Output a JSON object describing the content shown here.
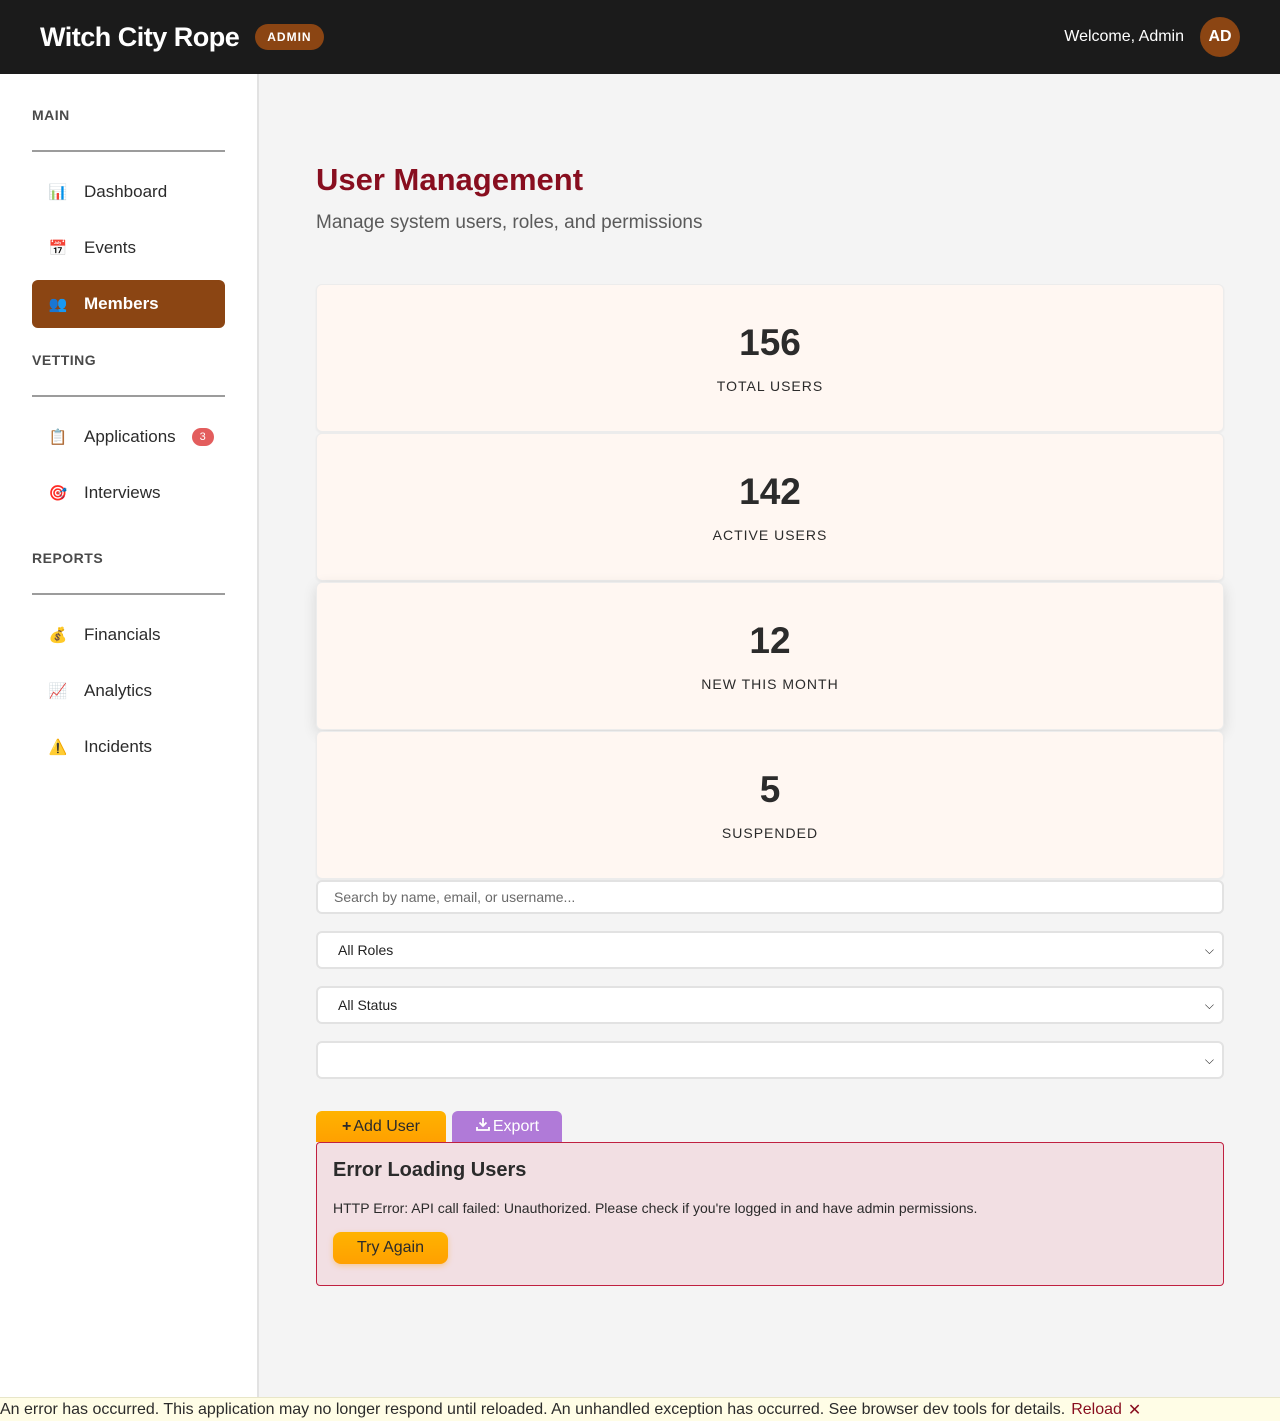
{
  "header": {
    "brand": "Witch City Rope",
    "badge": "ADMIN",
    "welcome": "Welcome, Admin",
    "avatar_initials": "AD"
  },
  "sidebar": {
    "sections": [
      {
        "title": "MAIN",
        "items": [
          {
            "label": "Dashboard",
            "icon": "bar-chart-icon",
            "glyph": "📊",
            "active": false
          },
          {
            "label": "Events",
            "icon": "calendar-icon",
            "glyph": "📅",
            "active": false
          },
          {
            "label": "Members",
            "icon": "people-icon",
            "glyph": "👥",
            "active": true
          }
        ]
      },
      {
        "title": "VETTING",
        "items": [
          {
            "label": "Applications",
            "icon": "clipboard-icon",
            "glyph": "📋",
            "active": false,
            "badge": "3"
          },
          {
            "label": "Interviews",
            "icon": "target-icon",
            "glyph": "🎯",
            "active": false
          }
        ]
      },
      {
        "title": "REPORTS",
        "items": [
          {
            "label": "Financials",
            "icon": "money-bag-icon",
            "glyph": "💰",
            "active": false
          },
          {
            "label": "Analytics",
            "icon": "trend-chart-icon",
            "glyph": "📈",
            "active": false
          },
          {
            "label": "Incidents",
            "icon": "warning-icon",
            "glyph": "⚠️",
            "active": false
          }
        ]
      }
    ]
  },
  "main": {
    "title": "User Management",
    "subtitle": "Manage system users, roles, and permissions",
    "stats": [
      {
        "value": "156",
        "label": "TOTAL USERS"
      },
      {
        "value": "142",
        "label": "ACTIVE USERS"
      },
      {
        "value": "12",
        "label": "NEW THIS MONTH"
      },
      {
        "value": "5",
        "label": "SUSPENDED"
      }
    ],
    "search_placeholder": "Search by name, email, or username...",
    "role_filter": "All Roles",
    "status_filter": "All Status",
    "third_filter": "",
    "add_user_label": "Add User",
    "export_label": "Export",
    "error": {
      "title": "Error Loading Users",
      "message": "HTTP Error: API call failed: Unauthorized. Please check if you're logged in and have admin permissions.",
      "retry_label": "Try Again"
    }
  },
  "error_bar": {
    "message": "An error has occurred. This application may no longer respond until reloaded. An unhandled exception has occurred. See browser dev tools for details.",
    "reload_label": "Reload",
    "dismiss_glyph": "✕"
  },
  "colors": {
    "header_bg": "#1b1b1b",
    "accent_brown": "#8b4513",
    "title_red": "#880e1f",
    "button_amber": "#ffa000",
    "button_purple": "#b07ad8",
    "error_bg": "#f2dfe3"
  }
}
